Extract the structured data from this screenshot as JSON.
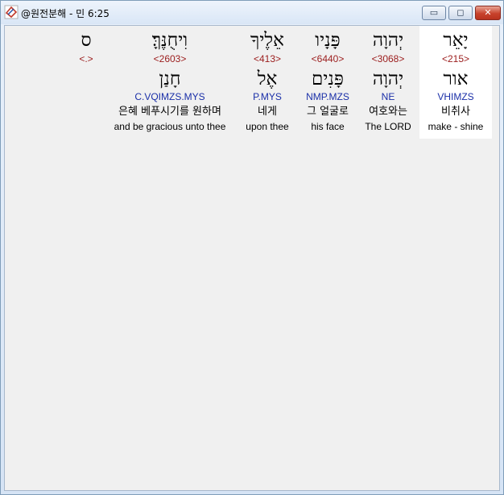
{
  "window": {
    "title": "@원전분해 - 민 6:25",
    "min_glyph": "▭",
    "max_glyph": "◻",
    "close_glyph": "✕"
  },
  "columns": [
    {
      "hebrew": "יָאֵר",
      "strong": "<215>",
      "root": "אור",
      "morph": "VHIMZS",
      "korean": "비취사",
      "english": "make - shine",
      "selected": true
    },
    {
      "hebrew": "יְהוָה",
      "strong": "<3068>",
      "root": "יְהוָה",
      "morph": "NE",
      "korean": "여호와는",
      "english": "The LORD",
      "selected": false
    },
    {
      "hebrew": "פָּנָיו",
      "strong": "<6440>",
      "root": "פָּנִים",
      "morph": "NMP.MZS",
      "korean": "그 얼굴로",
      "english": "his face",
      "selected": false
    },
    {
      "hebrew": "אֵלֶיךָ",
      "strong": "<413>",
      "root": "אֶל",
      "morph": "P.MYS",
      "korean": "네게",
      "english": "upon thee",
      "selected": false
    },
    {
      "hebrew": "וִיחֻנֶּךָּ׃",
      "strong": "<2603>",
      "root": "חָנַן",
      "morph": "C.VQIMZS.MYS",
      "korean": "은혜 베푸시기를 원하며",
      "english": "and be gracious unto thee",
      "selected": false
    },
    {
      "hebrew": "ס",
      "strong": "<.>",
      "root": "",
      "morph": "",
      "korean": "",
      "english": "",
      "selected": false
    }
  ]
}
